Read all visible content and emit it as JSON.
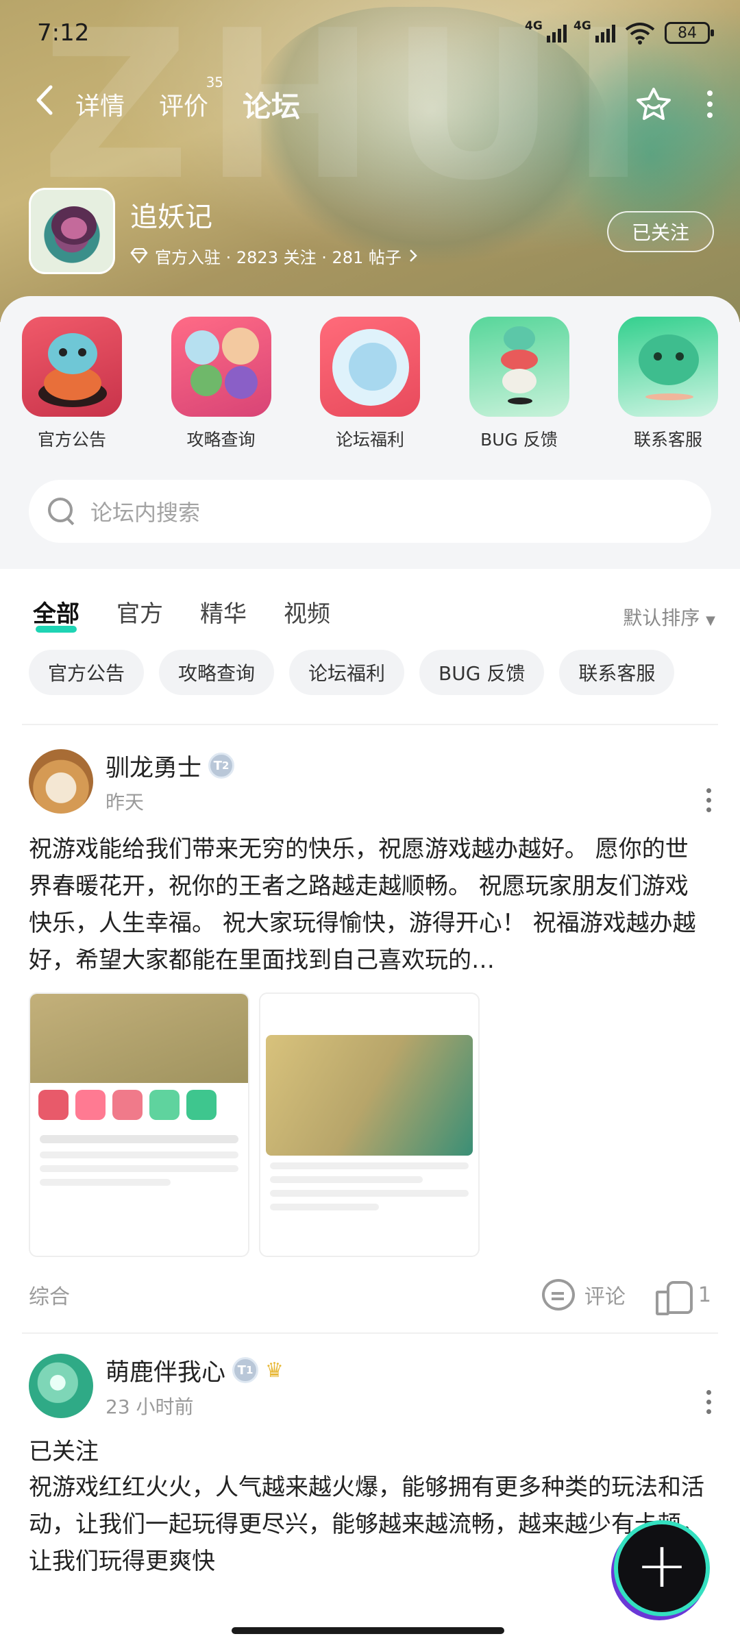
{
  "status_bar": {
    "time": "7:12",
    "net1": "4G",
    "net2": "4G",
    "battery": "84"
  },
  "nav": {
    "tabs": [
      {
        "label": "详情"
      },
      {
        "label": "评价",
        "count": "35"
      },
      {
        "label": "论坛"
      }
    ]
  },
  "game": {
    "name": "追妖记",
    "stats": "官方入驻 · 2823 关注 · 281 帖子",
    "follow_label": "已关注"
  },
  "quick_links": [
    {
      "label": "官方公告"
    },
    {
      "label": "攻略查询"
    },
    {
      "label": "论坛福利"
    },
    {
      "label": "BUG 反馈"
    },
    {
      "label": "联系客服"
    }
  ],
  "search": {
    "placeholder": "论坛内搜索"
  },
  "filter_tabs": [
    "全部",
    "官方",
    "精华",
    "视频"
  ],
  "sort_label": "默认排序",
  "chips": [
    "官方公告",
    "攻略查询",
    "论坛福利",
    "BUG 反馈",
    "联系客服"
  ],
  "posts": [
    {
      "author": "驯龙勇士",
      "level": "2",
      "time": "昨天",
      "body": "祝游戏能给我们带来无穷的快乐，祝愿游戏越办越好。 愿你的世界春暖花开，祝你的王者之路越走越顺畅。 祝愿玩家朋友们游戏快乐，人生幸福。 祝大家玩得愉快，游得开心！ 祝福游戏越办越好，希望大家都能在里面找到自己喜欢玩的…",
      "tag": "综合",
      "comment_label": "评论",
      "like_count": "1"
    },
    {
      "author": "萌鹿伴我心",
      "level": "1",
      "time": "23 小时前",
      "status": "已关注",
      "body": "祝游戏红红火火，人气越来越火爆，能够拥有更多种类的玩法和活动，让我们一起玩得更尽兴，能够越来越流畅，越来越少有卡顿，让我们玩得更爽快"
    }
  ],
  "fab_label": "+"
}
